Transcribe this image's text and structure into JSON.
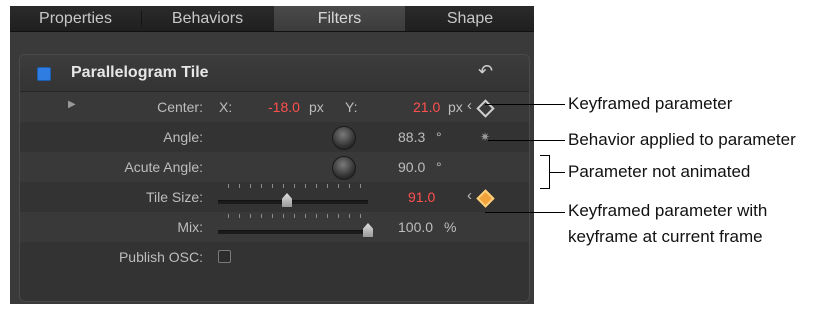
{
  "tabs": [
    "Properties",
    "Behaviors",
    "Filters",
    "Shape"
  ],
  "active_tab": "Filters",
  "filter": {
    "title": "Parallelogram Tile",
    "reset_icon": "reset-arrow-icon",
    "center": {
      "label": "Center:",
      "x_label": "X:",
      "x_value": "-18.0",
      "x_unit": "px",
      "y_label": "Y:",
      "y_value": "21.0",
      "y_unit": "px"
    },
    "angle": {
      "label": "Angle:",
      "value": "88.3",
      "unit": "°"
    },
    "acute_angle": {
      "label": "Acute Angle:",
      "value": "90.0",
      "unit": "°"
    },
    "tile_size": {
      "label": "Tile Size:",
      "value": "91.0",
      "slider": 0.46
    },
    "mix": {
      "label": "Mix:",
      "value": "100.0",
      "unit": "%",
      "slider": 1.0
    },
    "publish_osc": {
      "label": "Publish OSC:",
      "checked": false
    }
  },
  "callouts": {
    "keyframed": "Keyframed parameter",
    "behavior": "Behavior applied to parameter",
    "not_animated": "Parameter not animated",
    "keyframe_current_1": "Keyframed parameter with",
    "keyframe_current_2": "keyframe at current frame"
  },
  "colors": {
    "animated_value": "#ff4f4f",
    "enable_checkbox": "#2f7de0",
    "current_keyframe": "#f2a23a"
  }
}
